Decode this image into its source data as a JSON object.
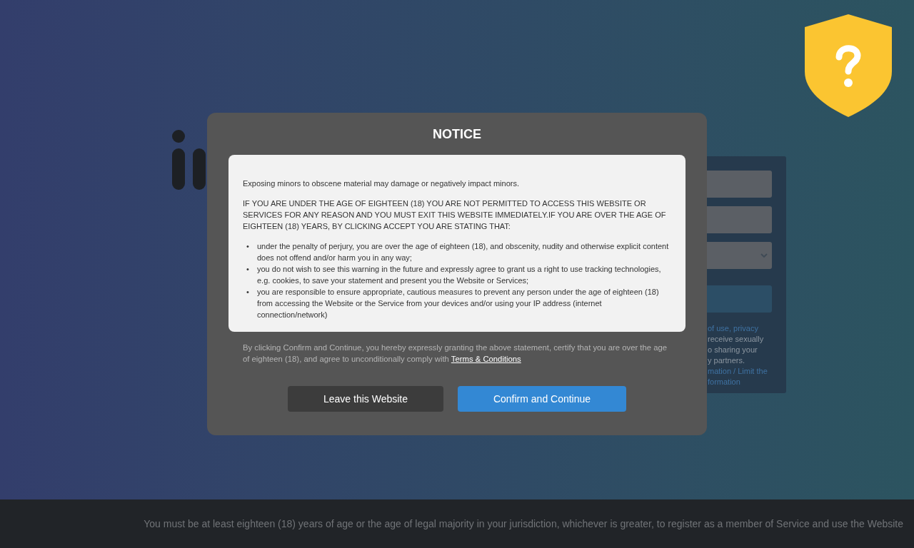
{
  "signup_card": {
    "fields": [
      {
        "kind": "text"
      },
      {
        "kind": "text"
      },
      {
        "kind": "select"
      }
    ],
    "lines": [
      {
        "kind": "link",
        "text": "of use, privacy"
      },
      {
        "kind": "plain",
        "text": "receive sexually"
      },
      {
        "kind": "plain",
        "text": "o sharing your"
      },
      {
        "kind": "plain",
        "text": "y partners."
      },
      {
        "kind": "link",
        "text": "mation / Limit the"
      },
      {
        "kind": "link",
        "text": "formation"
      }
    ]
  },
  "modal": {
    "title": "NOTICE",
    "intro": "Exposing minors to obscene material may damage or negatively impact minors.",
    "warning": "IF YOU ARE UNDER THE AGE OF EIGHTEEN (18) YOU ARE NOT PERMITTED TO ACCESS THIS WEBSITE OR SERVICES FOR ANY REASON AND YOU MUST EXIT THIS WEBSITE IMMEDIATELY.IF YOU ARE OVER THE AGE OF EIGHTEEN (18) YEARS, BY CLICKING ACCEPT YOU ARE STATING THAT:",
    "bullet": "•",
    "statements": [
      "under the penalty of perjury, you are over the age of eighteen (18), and obscenity, nudity and otherwise explicit content does not offend and/or harm you in any way;",
      "you do not wish to see this warning in the future and expressly agree to grant us a right to use tracking technologies, e.g. cookies, to save your statement and present you the Website or Services;",
      "you are responsible to ensure appropriate, cautious measures to prevent any person under the age of eighteen (18) from accessing the Website or the Service from your devices and/or using your IP address (internet connection/network)"
    ],
    "consent": "By clicking Confirm and Continue, you hereby expressly granting the above statement, certify that you are over the age of eighteen (18), and agree to unconditionally comply with",
    "terms_link": "Terms & Conditions",
    "buttons": [
      {
        "kind": "secondary",
        "label": "Leave this Website"
      },
      {
        "kind": "primary",
        "label": "Confirm and Continue"
      }
    ]
  },
  "footer": "You must be at least eighteen (18) years of age or the age of legal majority in your jurisdiction, whichever is greater, to register as a member of Service and use the Website"
}
